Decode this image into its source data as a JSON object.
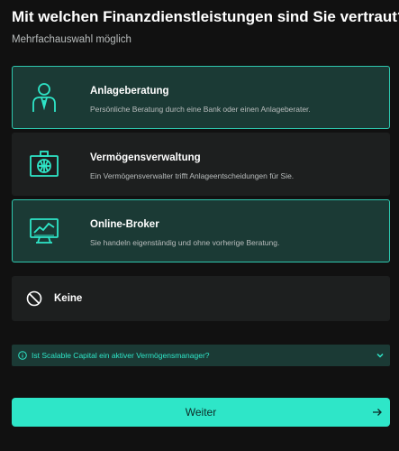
{
  "header": {
    "title": "Mit welchen Finanzdienstleistungen sind Sie vertraut?",
    "subtitle": "Mehrfachauswahl möglich"
  },
  "options": [
    {
      "title": "Anlageberatung",
      "description": "Persönliche Beratung durch eine Bank oder einen Anlageberater.",
      "icon": "advisor-person-icon",
      "selected": true
    },
    {
      "title": "Vermögensverwaltung",
      "description": "Ein Vermögensverwalter trifft Anlageentscheidungen für Sie.",
      "icon": "globe-briefcase-icon",
      "selected": false
    },
    {
      "title": "Online-Broker",
      "description": "Sie handeln eigenständig und ohne vorherige Beratung.",
      "icon": "chart-monitor-icon",
      "selected": true
    },
    {
      "title": "Keine",
      "icon": "forbidden-icon",
      "selected": false
    }
  ],
  "faq": {
    "question": "Ist Scalable Capital ein aktiver Vermögensmanager?",
    "icon": "info-circle-icon",
    "expanded": false
  },
  "cta": {
    "label": "Weiter",
    "icon": "arrow-right-icon"
  },
  "colors": {
    "background": "#111111",
    "card": "#1d1f1f",
    "card_selected": "#1b3a35",
    "accent": "#2ee6c8"
  }
}
